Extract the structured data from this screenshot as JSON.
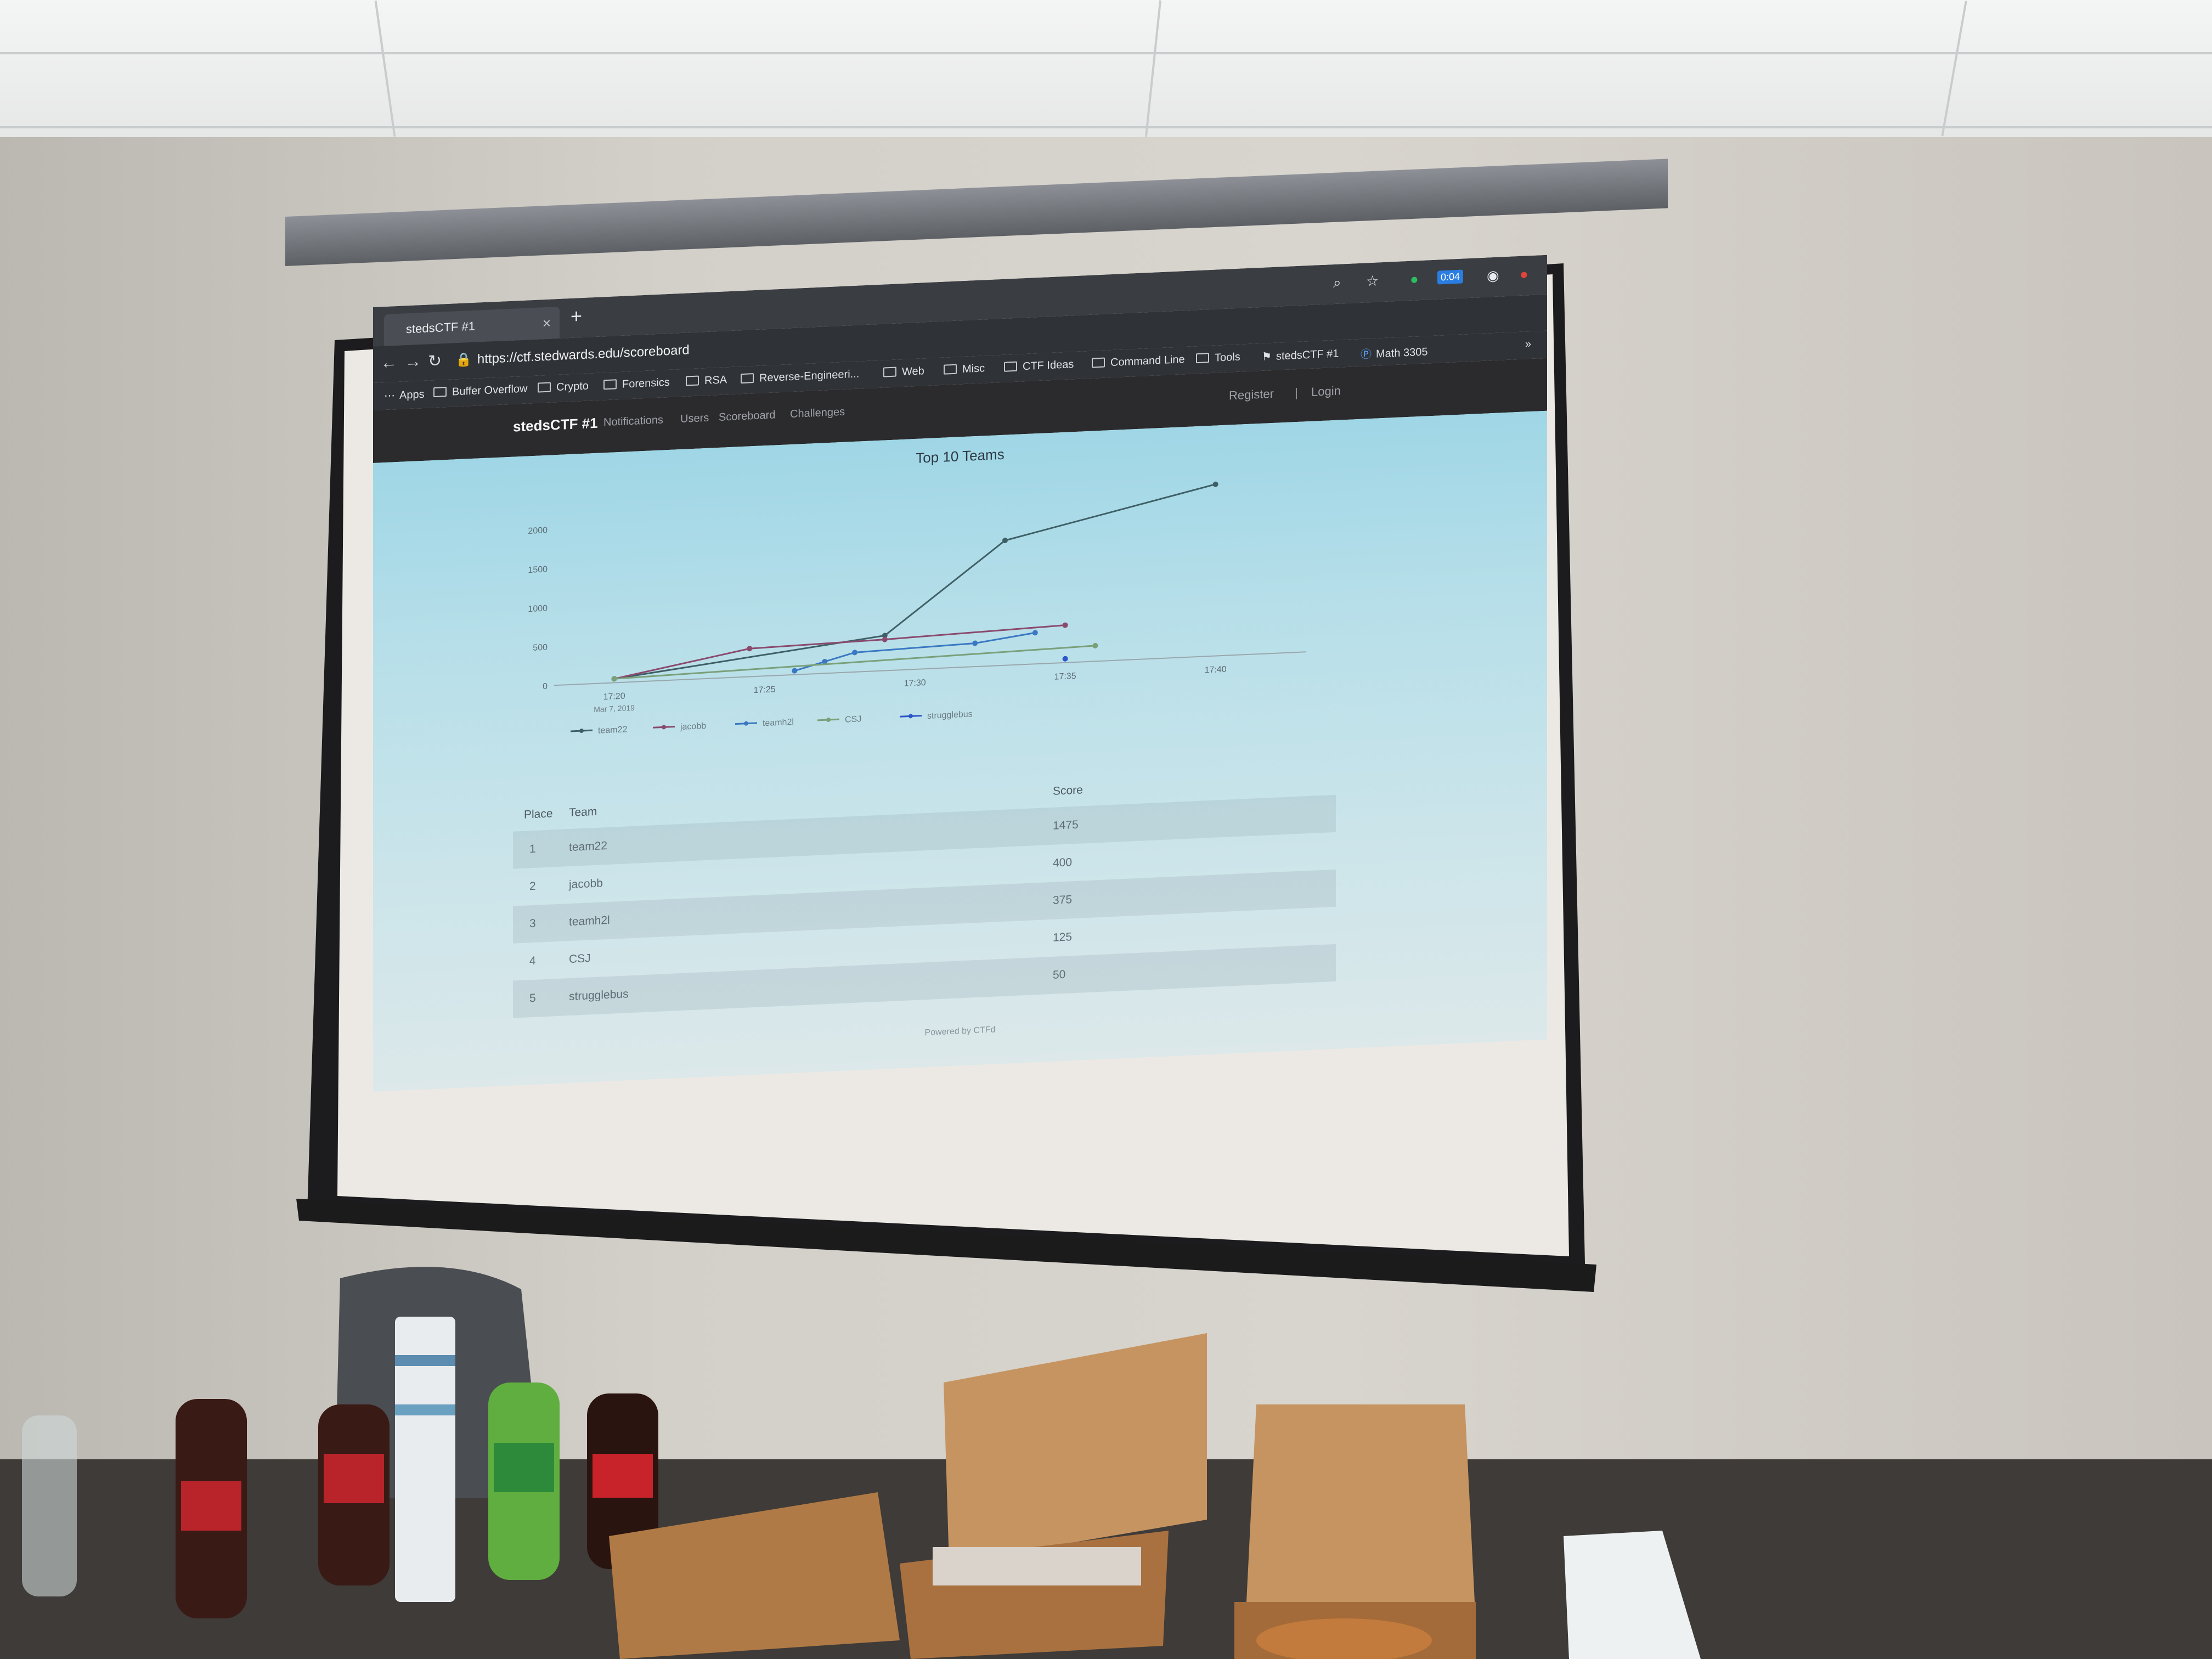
{
  "browser": {
    "tab_title": "stedsCTF #1",
    "new_tab": "+",
    "tab_close": "×",
    "url": "https://ctf.stedwards.edu/scoreboard",
    "timer_badge": "0:04",
    "bookmarks": [
      "Apps",
      "Buffer Overflow",
      "Crypto",
      "Forensics",
      "RSA",
      "Reverse-Engineeri...",
      "Web",
      "Misc",
      "CTF Ideas",
      "Command Line",
      "Tools",
      "stedsCTF #1",
      "Math 3305"
    ],
    "more": "»"
  },
  "ctf_nav": {
    "brand": "stedsCTF #1",
    "links": [
      "Notifications",
      "Users",
      "Scoreboard",
      "Challenges"
    ],
    "register": "Register",
    "separator": "|",
    "login": "Login"
  },
  "chart_data": {
    "type": "line",
    "title": "Top 10 Teams",
    "y_ticks": [
      "0",
      "500",
      "1000",
      "1500",
      "2000"
    ],
    "x_ticks": [
      "17:20",
      "17:25",
      "17:30",
      "17:35",
      "17:40"
    ],
    "x_subtitle": "Mar 7, 2019",
    "ylim": [
      0,
      2250
    ],
    "legend_placement": "bottom",
    "series": [
      {
        "name": "team22",
        "color": "#3f5f66",
        "x": [
          17.2,
          17.29,
          17.33,
          17.4
        ],
        "y": [
          50,
          450,
          1600,
          2200
        ]
      },
      {
        "name": "jacobb",
        "color": "#8a4a6e",
        "x": [
          17.2,
          17.245,
          17.29,
          17.35
        ],
        "y": [
          50,
          360,
          400,
          480
        ]
      },
      {
        "name": "teamh2l",
        "color": "#3a78c2",
        "x": [
          17.26,
          17.27,
          17.28,
          17.32,
          17.34
        ],
        "y": [
          50,
          150,
          250,
          300,
          400
        ]
      },
      {
        "name": "CSJ",
        "color": "#7aa07a",
        "x": [
          17.2,
          17.36
        ],
        "y": [
          50,
          200
        ]
      },
      {
        "name": "strugglebus",
        "color": "#2c56c8",
        "x": [
          17.35
        ],
        "y": [
          50
        ]
      }
    ]
  },
  "scoreboard": {
    "headers": {
      "place": "Place",
      "team": "Team",
      "score": "Score"
    },
    "rows": [
      {
        "place": "1",
        "team": "team22",
        "score": "1475"
      },
      {
        "place": "2",
        "team": "jacobb",
        "score": "400"
      },
      {
        "place": "3",
        "team": "teamh2l",
        "score": "375"
      },
      {
        "place": "4",
        "team": "CSJ",
        "score": "125"
      },
      {
        "place": "5",
        "team": "strugglebus",
        "score": "50"
      }
    ]
  },
  "footer": "Powered by CTFd"
}
